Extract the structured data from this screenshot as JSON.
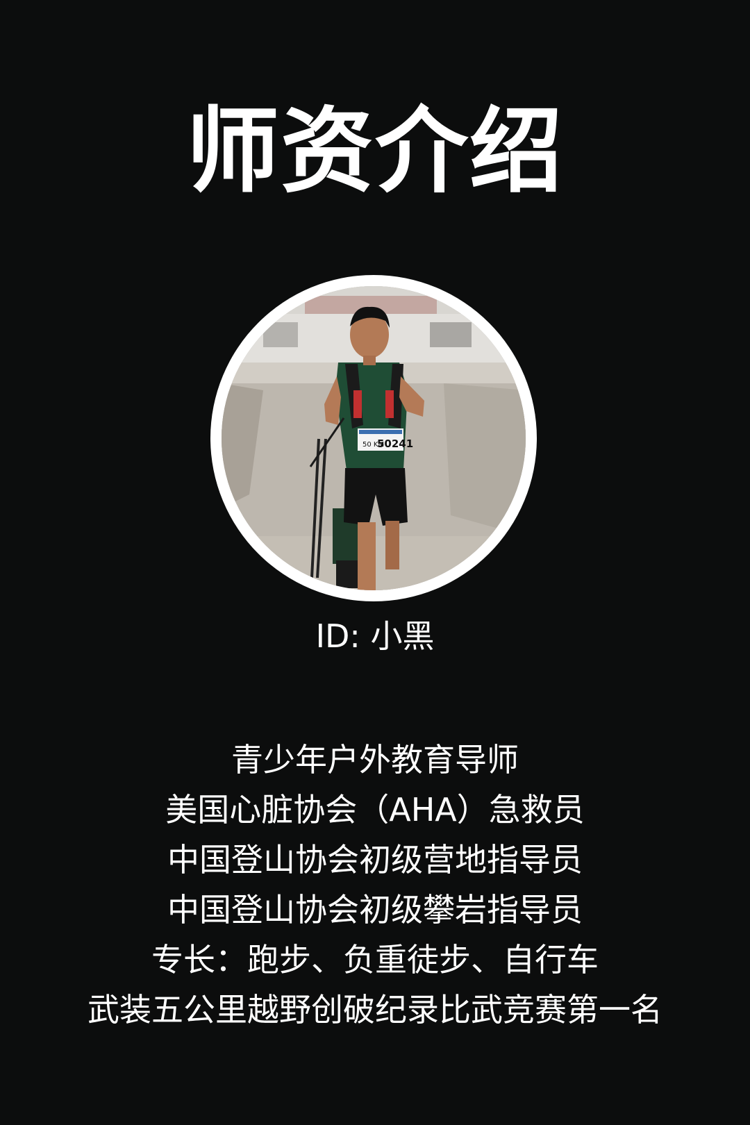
{
  "header": {
    "title": "师资介绍"
  },
  "profile": {
    "photo": {
      "icon": "runner-portrait-photo",
      "bib_number": "50241",
      "bib_prefix": "50 KM"
    },
    "id_text": "ID: 小黑"
  },
  "bio": {
    "items": [
      "青少年户外教育导师",
      "美国心脏协会（AHA）急救员",
      "中国登山协会初级营地指导员",
      "中国登山协会初级攀岩指导员",
      "专长：跑步、负重徒步、自行车",
      "武装五公里越野创破纪录比武竞赛第一名"
    ]
  },
  "colors": {
    "background": "#0c0d0d",
    "text": "#ffffff",
    "frame": "#ffffff"
  }
}
